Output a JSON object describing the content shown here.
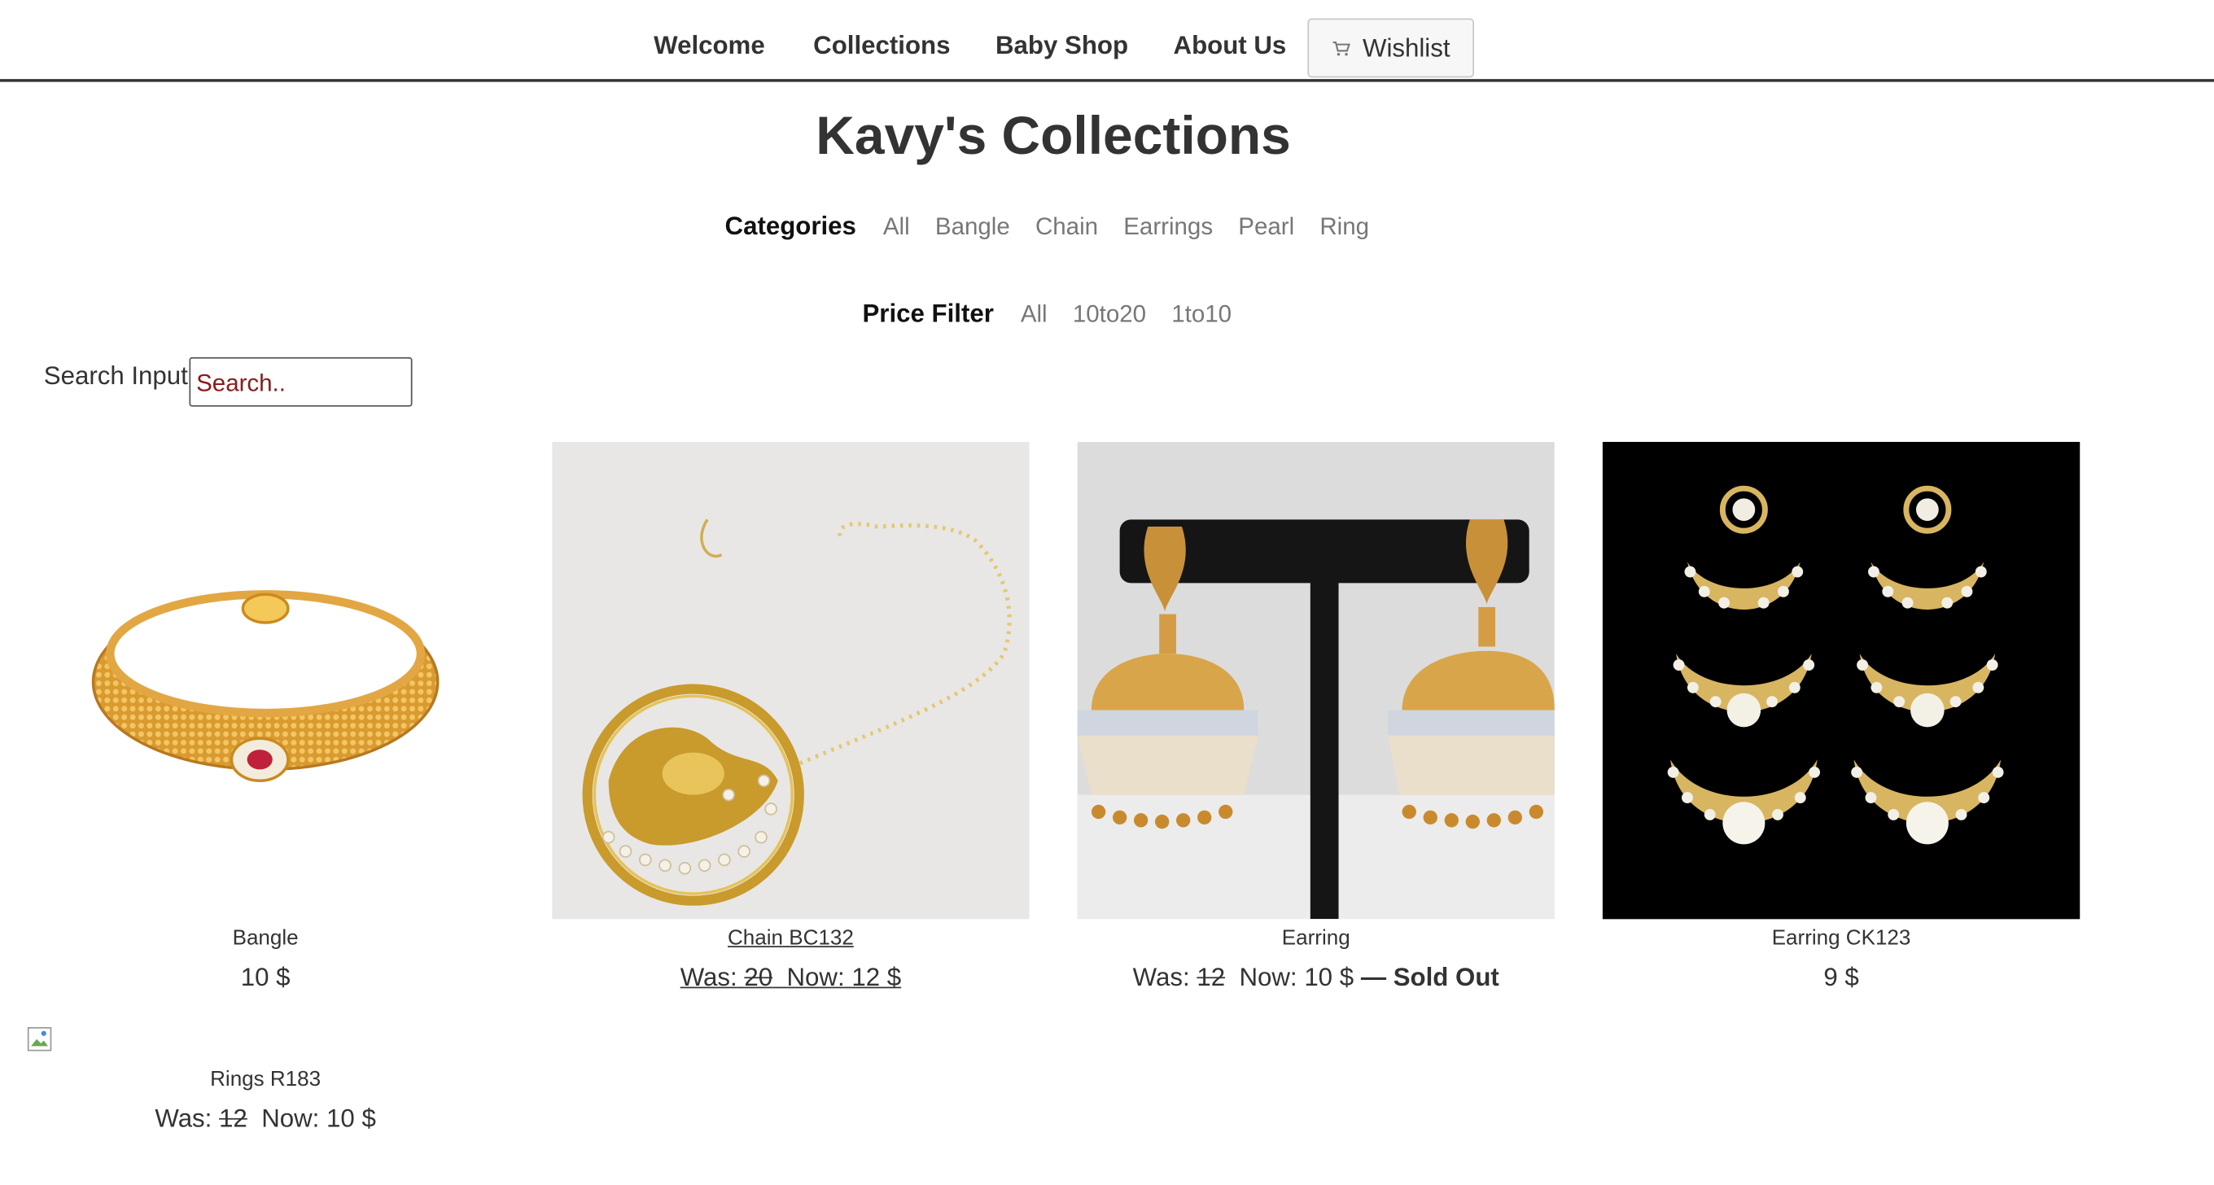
{
  "nav": {
    "items": [
      "Welcome",
      "Collections",
      "Baby Shop",
      "About Us"
    ],
    "wishlist_label": "Wishlist",
    "wishlist_icon": "cart-icon"
  },
  "page_title": "Kavy's Collections",
  "categories": {
    "label": "Categories",
    "options": [
      "All",
      "Bangle",
      "Chain",
      "Earrings",
      "Pearl",
      "Ring"
    ]
  },
  "price_filter": {
    "label": "Price Filter",
    "options": [
      "All",
      "10to20",
      "1to10"
    ]
  },
  "search": {
    "label": "Search Input:",
    "placeholder": "Search.."
  },
  "products": [
    {
      "name": "Bangle",
      "price": "10 $"
    },
    {
      "name": "Chain BC132",
      "was_label": "Was:",
      "was_value": "20",
      "now_label": "Now:",
      "now_value": "12 $"
    },
    {
      "name": "Earring",
      "was_label": "Was:",
      "was_value": "12",
      "now_label": "Now:",
      "now_value": "10 $",
      "status": "— Sold Out"
    },
    {
      "name": "Earring CK123",
      "price": "9 $"
    },
    {
      "name": "Rings R183",
      "was_label": "Was:",
      "was_value": "12",
      "now_label": "Now:",
      "now_value": "10 $"
    }
  ],
  "colors": {
    "text": "#333333",
    "muted_link": "#777777",
    "search_text": "#8b1a1a",
    "gold": "#d4a537",
    "dark_bg": "#000000"
  }
}
